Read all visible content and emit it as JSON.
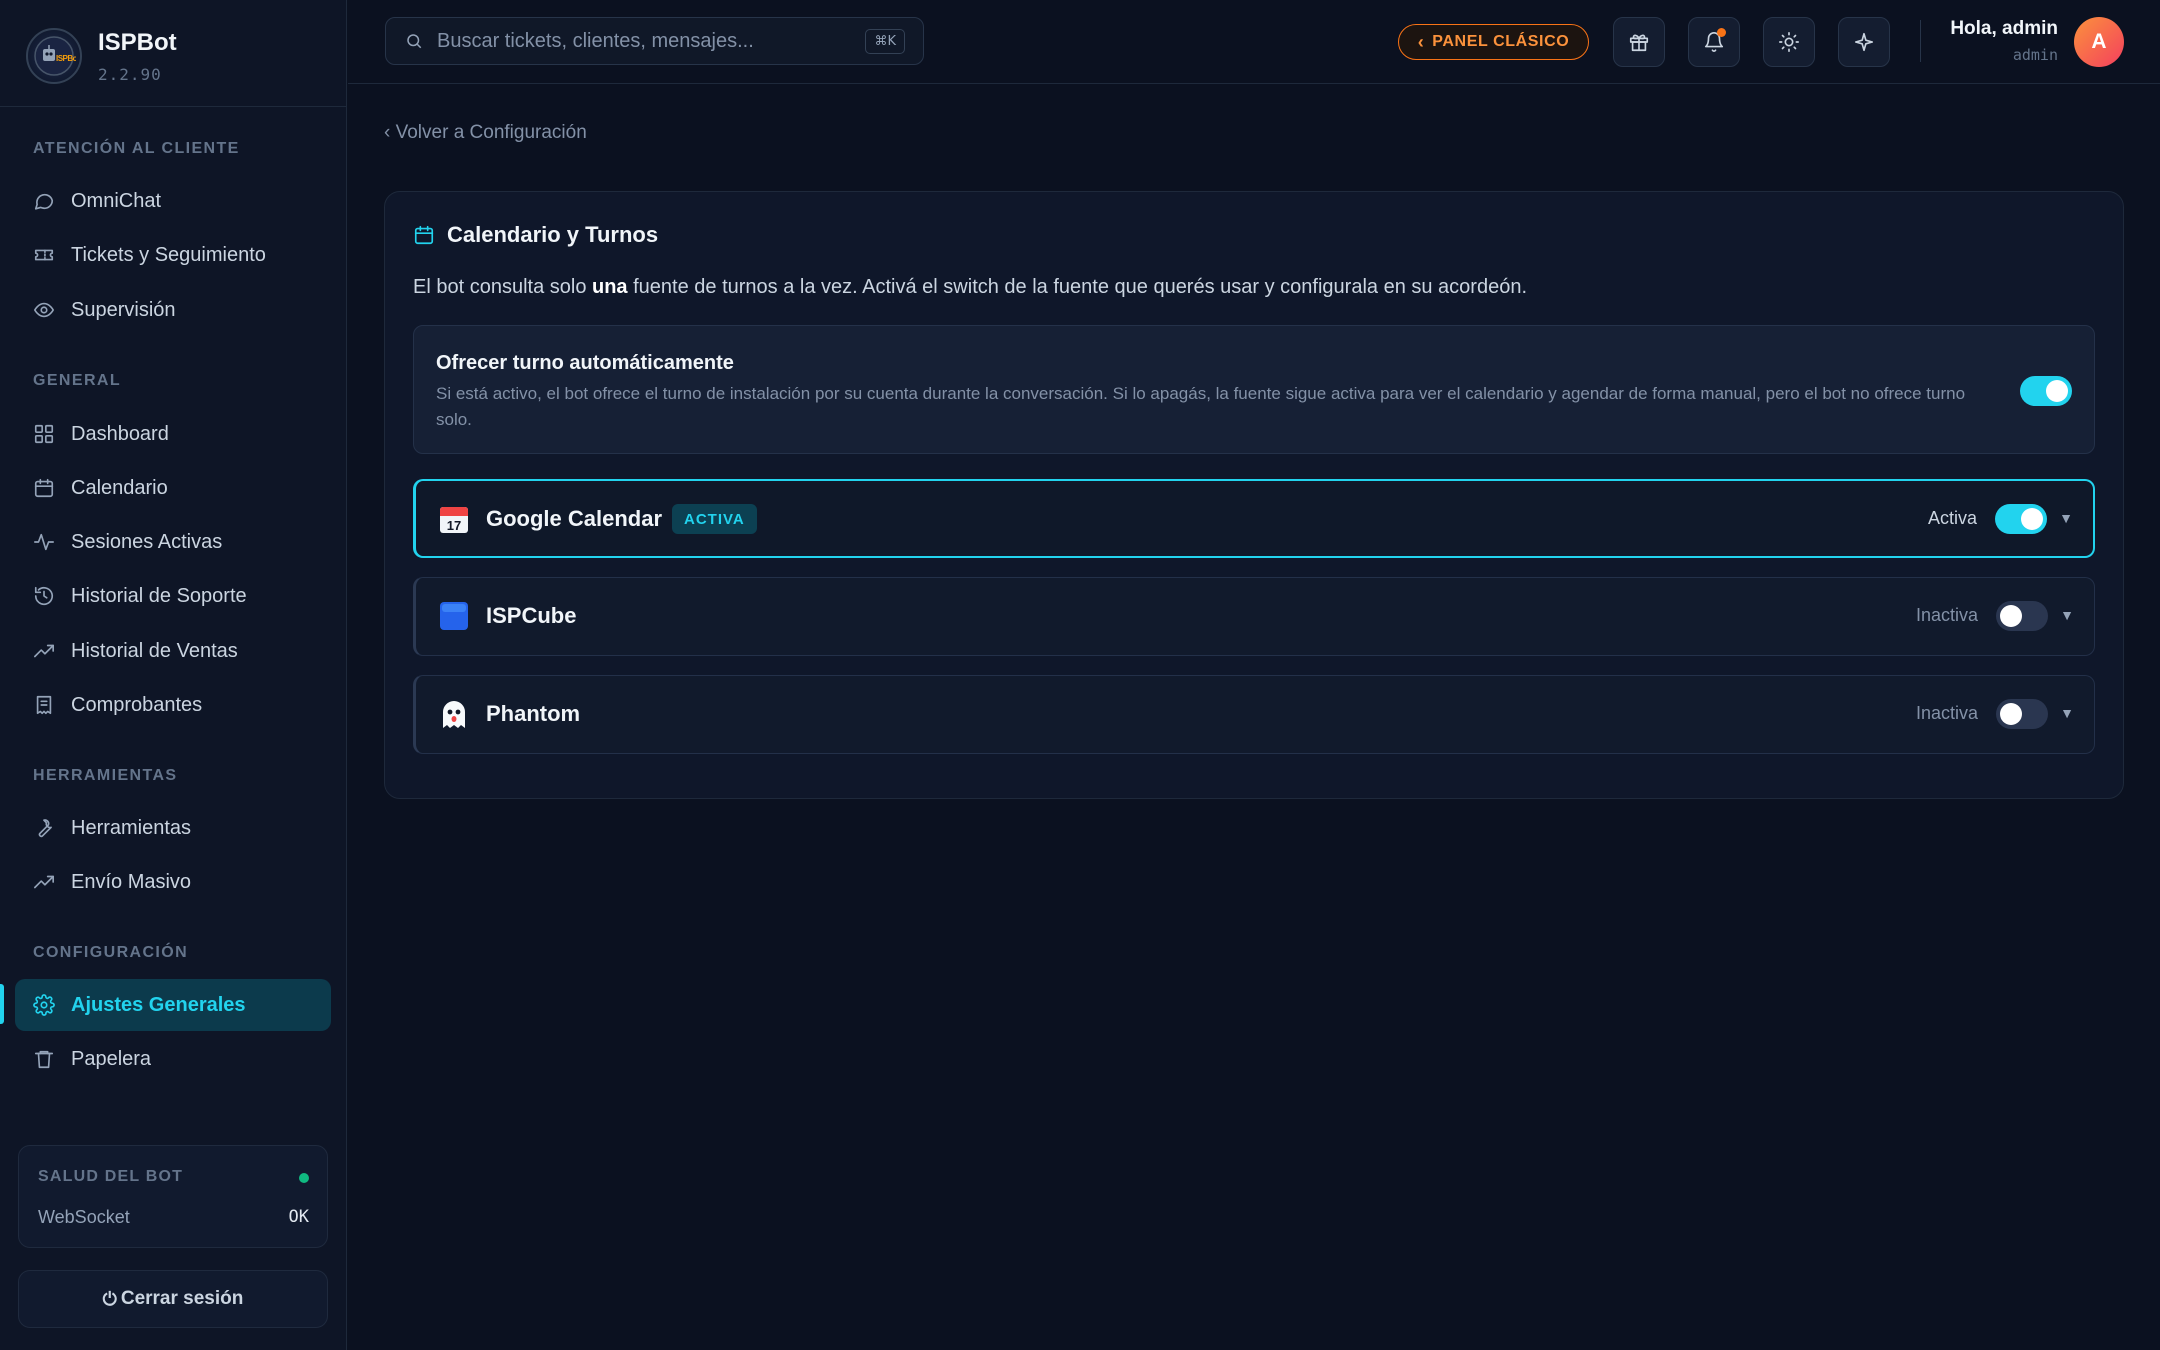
{
  "brand": {
    "name": "ISPBot",
    "version": "2.2.90",
    "logo_text": "ISPBot"
  },
  "sidebar": {
    "sections": [
      {
        "label": "ATENCIÓN AL CLIENTE"
      },
      {
        "label": "GENERAL"
      },
      {
        "label": "HERRAMIENTAS"
      },
      {
        "label": "CONFIGURACIÓN"
      }
    ],
    "items": [
      {
        "label": "OmniChat",
        "icon": "chat-bubble-icon"
      },
      {
        "label": "Tickets y Seguimiento",
        "icon": "ticket-icon"
      },
      {
        "label": "Supervisión",
        "icon": "eye-icon"
      },
      {
        "label": "Dashboard",
        "icon": "grid-icon"
      },
      {
        "label": "Calendario",
        "icon": "calendar-icon"
      },
      {
        "label": "Sesiones Activas",
        "icon": "activity-icon"
      },
      {
        "label": "Historial de Soporte",
        "icon": "history-icon"
      },
      {
        "label": "Historial de Ventas",
        "icon": "trending-up-icon"
      },
      {
        "label": "Comprobantes",
        "icon": "receipt-icon"
      },
      {
        "label": "Herramientas",
        "icon": "wrench-icon"
      },
      {
        "label": "Envío Masivo",
        "icon": "trending-up-icon"
      },
      {
        "label": "Ajustes Generales",
        "icon": "gear-icon",
        "active": true
      },
      {
        "label": "Papelera",
        "icon": "trash-icon"
      }
    ],
    "health": {
      "title": "SALUD DEL BOT",
      "key": "WebSocket",
      "value": "OK",
      "status_color": "#10b981"
    },
    "logout_label": "Cerrar sesión"
  },
  "topbar": {
    "search_placeholder": "Buscar tickets, clientes, mensajes...",
    "search_shortcut": "⌘K",
    "classic_panel_label": "PANEL CLÁSICO",
    "greeting": "Hola, admin",
    "role": "admin",
    "avatar_initial": "A"
  },
  "main": {
    "back_link": "‹ Volver a Configuración",
    "card": {
      "title": "Calendario y Turnos",
      "desc_prefix": "El bot consulta solo ",
      "desc_bold": "una",
      "desc_suffix": " fuente de turnos a la vez. Activá el switch de la fuente que querés usar y configurala en su acordeón.",
      "auto_offer": {
        "title": "Ofrecer turno automáticamente",
        "description": "Si está activo, el bot ofrece el turno de instalación por su cuenta durante la conversación. Si lo apagás, la fuente sigue activa para ver el calendario y agendar de forma manual, pero el bot no ofrece turno solo.",
        "enabled": true
      },
      "sources": [
        {
          "name": "Google Calendar",
          "emoji": "📅",
          "badge": "ACTIVA",
          "status": "Activa",
          "enabled": true
        },
        {
          "name": "ISPCube",
          "emoji": "🟦",
          "status": "Inactiva",
          "enabled": false
        },
        {
          "name": "Phantom",
          "emoji": "👻",
          "status": "Inactiva",
          "enabled": false
        }
      ]
    }
  },
  "colors": {
    "accent": "#22d3ee",
    "warning": "#f97316",
    "background": "#0b1120"
  }
}
